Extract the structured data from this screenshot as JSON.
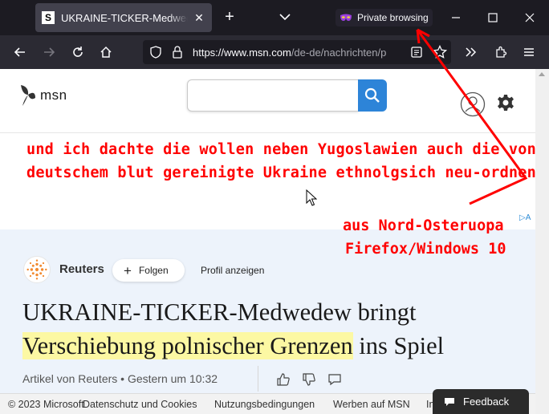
{
  "browser": {
    "tab_title": "UKRAINE-TICKER-Medwedew bringt Verschiebung polnischer Grenzen ins Spiel",
    "tab_favicon": "S",
    "private_label": "Private browsing",
    "url_domain": "https://www.msn.com",
    "url_path": "/de-de/nachrichten/p",
    "icons": [
      "back-icon",
      "forward-icon",
      "reload-icon",
      "home-icon",
      "shield-icon",
      "lock-icon",
      "reader-view-icon",
      "bookmark-star-icon",
      "overflow-icon",
      "extensions-icon",
      "menu-icon"
    ]
  },
  "msn": {
    "logo_text": "msn",
    "search_placeholder": ""
  },
  "annotation": {
    "line1": "und ich dachte die wollen neben Yugoslawien auch die von",
    "line2": "deutschem blut gereinigte Ukraine ethnolgsich neu-ordnen",
    "line3": "aus Nord-Osteruopa",
    "line4": "Firefox/Windows 10",
    "color": "#ff0000"
  },
  "ad_marker": "A",
  "article": {
    "source": "Reuters",
    "follow_label": "Folgen",
    "profile_label": "Profil anzeigen",
    "headline_part1": "UKRAINE-TICKER-Medwedew bringt",
    "headline_highlight": "Verschiebung polnischer Grenzen",
    "headline_part2": " ins Spiel",
    "byline": "Artikel von Reuters • Gestern um 10:32",
    "highlight_color": "#fcf8a3"
  },
  "footer": {
    "copyright": "© 2023 Microsoft",
    "privacy": "Datenschutz und Cookies",
    "terms": "Nutzungsbedingungen",
    "advertise": "Werben auf MSN",
    "more": "In",
    "feedback": "Feedback"
  }
}
